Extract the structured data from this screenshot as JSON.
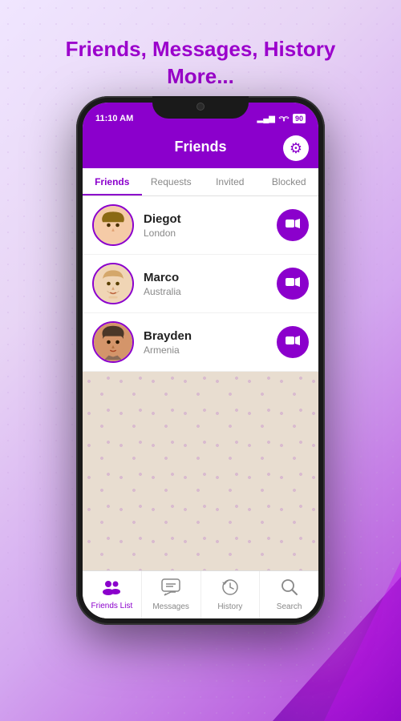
{
  "page": {
    "title_line1": "Friends, Messages, History",
    "title_line2": "More..."
  },
  "status_bar": {
    "time": "11:10 AM",
    "signal": "▂▄▆",
    "wifi": "WiFi",
    "battery": "90"
  },
  "header": {
    "title": "Friends",
    "gear_label": "⚙"
  },
  "tabs": [
    {
      "id": "friends",
      "label": "Friends",
      "active": true
    },
    {
      "id": "requests",
      "label": "Requests",
      "active": false
    },
    {
      "id": "invited",
      "label": "Invited",
      "active": false
    },
    {
      "id": "blocked",
      "label": "Blocked",
      "active": false
    }
  ],
  "friends": [
    {
      "id": 1,
      "name": "Diegot",
      "location": "London",
      "hair_color": "#8B6914",
      "skin_color": "#F5CBA7"
    },
    {
      "id": 2,
      "name": "Marco",
      "location": "Australia",
      "hair_color": "#D4A76A",
      "skin_color": "#F0D5B5"
    },
    {
      "id": 3,
      "name": "Brayden",
      "location": "Armenia",
      "hair_color": "#4A3728",
      "skin_color": "#D4956A"
    }
  ],
  "bottom_nav": [
    {
      "id": "friends-list",
      "label": "Friends List",
      "icon": "👥",
      "active": true
    },
    {
      "id": "messages",
      "label": "Messages",
      "icon": "💬",
      "active": false
    },
    {
      "id": "history",
      "label": "History",
      "icon": "🕐",
      "active": false
    },
    {
      "id": "search",
      "label": "Search",
      "icon": "🔍",
      "active": false
    }
  ]
}
